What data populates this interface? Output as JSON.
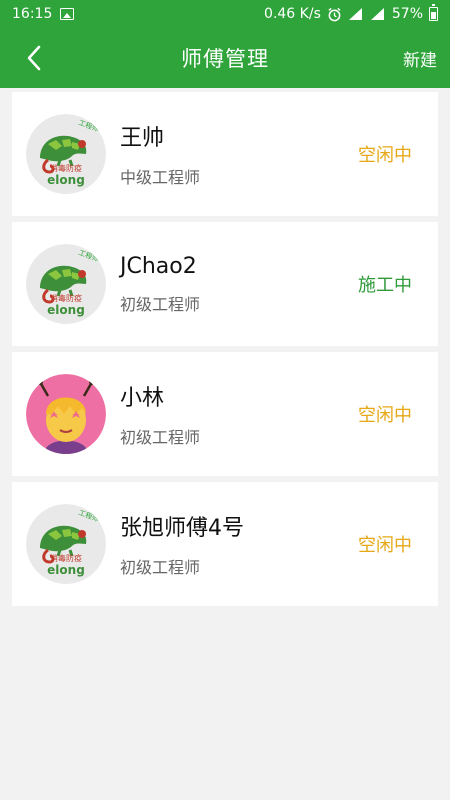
{
  "statusbar": {
    "time": "16:15",
    "net_speed": "0.46 K/s",
    "battery": "57%"
  },
  "appbar": {
    "title": "师傅管理",
    "new_label": "新建"
  },
  "engineers": [
    {
      "name": "王帅",
      "level": "中级工程师",
      "status": "空闲中",
      "status_type": "idle",
      "avatar": "elong-logo"
    },
    {
      "name": "JChao2",
      "level": "初级工程师",
      "status": "施工中",
      "status_type": "working",
      "avatar": "elong-logo"
    },
    {
      "name": "小林",
      "level": "初级工程师",
      "status": "空闲中",
      "status_type": "idle",
      "avatar": "cartoon-girl"
    },
    {
      "name": "张旭师傅4号",
      "level": "初级工程师",
      "status": "空闲中",
      "status_type": "idle",
      "avatar": "elong-logo"
    }
  ],
  "logo": {
    "badge_text": "工程师",
    "brand_cn": "消毒防疫",
    "brand_en": "elong"
  },
  "colors": {
    "primary": "#2ea43a",
    "idle": "#e6a817",
    "working": "#2f9b3a"
  }
}
